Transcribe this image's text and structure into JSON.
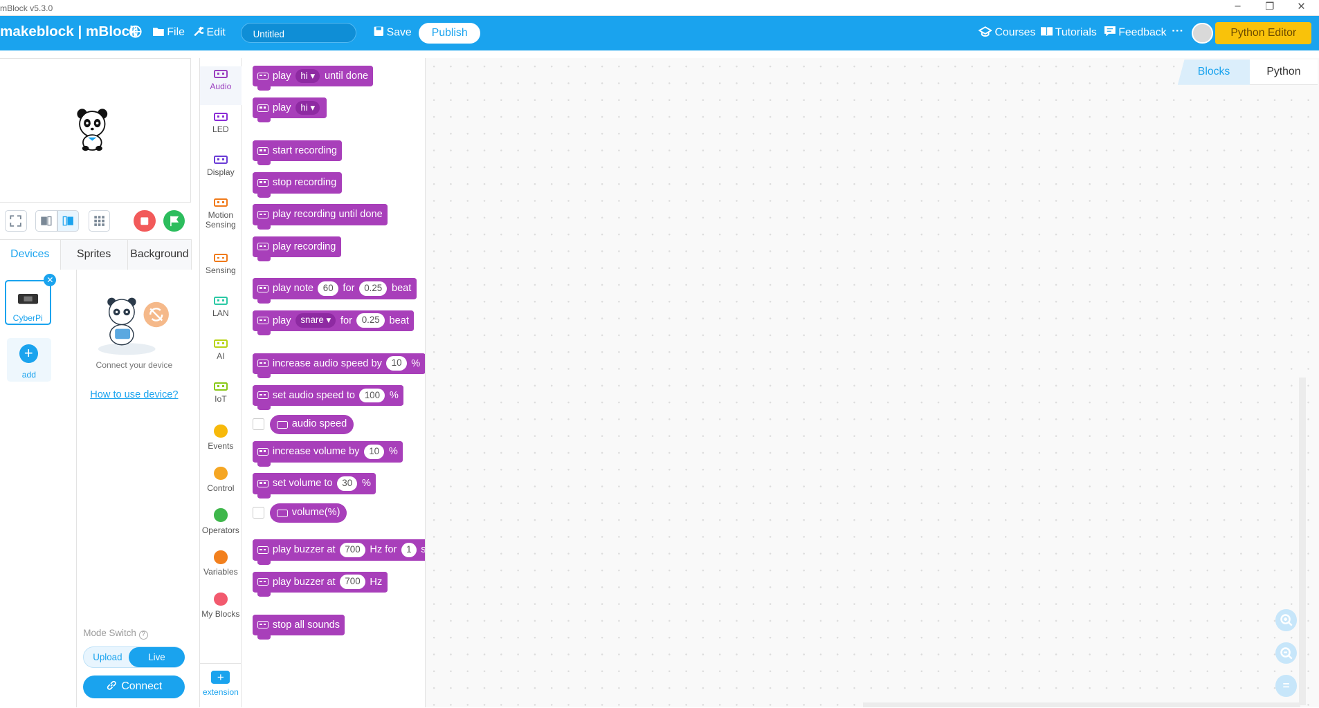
{
  "window": {
    "title": "mBlock v5.3.0",
    "minimize": "–",
    "restore": "❐",
    "close": "✕"
  },
  "menubar": {
    "brand": "makeblock | mBlock",
    "file": "File",
    "edit": "Edit",
    "project_title": "Untitled",
    "save": "Save",
    "publish": "Publish",
    "courses": "Courses",
    "tutorials": "Tutorials",
    "feedback": "Feedback",
    "more": "···",
    "python_editor": "Python Editor"
  },
  "tabs": {
    "devices": "Devices",
    "sprites": "Sprites",
    "background": "Background"
  },
  "devices": {
    "items": [
      {
        "label": "CyberPi"
      }
    ],
    "add_label": "add",
    "connect_hint": "Connect your device",
    "how_to_link": "How to use device?",
    "mode_switch_label": "Mode Switch",
    "mode_upload": "Upload",
    "mode_live": "Live",
    "connect_button": "Connect"
  },
  "categories": [
    {
      "label": "Audio",
      "color": "#9b3fbf",
      "shape": "chip"
    },
    {
      "label": "LED",
      "color": "#8a2bd6",
      "shape": "chip"
    },
    {
      "label": "Display",
      "color": "#6a3bd6",
      "shape": "chip"
    },
    {
      "label": "Motion Sensing",
      "color": "#f07a1a",
      "shape": "chip"
    },
    {
      "label": "Sensing",
      "color": "#f07a1a",
      "shape": "chip"
    },
    {
      "label": "LAN",
      "color": "#2bc9a5",
      "shape": "chip"
    },
    {
      "label": "AI",
      "color": "#b8d414",
      "shape": "chip"
    },
    {
      "label": "IoT",
      "color": "#8bc91a",
      "shape": "chip"
    },
    {
      "label": "Events",
      "color": "#f7b90a",
      "shape": "dot"
    },
    {
      "label": "Control",
      "color": "#f5a623",
      "shape": "dot"
    },
    {
      "label": "Operators",
      "color": "#3fb74b",
      "shape": "dot"
    },
    {
      "label": "Variables",
      "color": "#f2801e",
      "shape": "dot"
    },
    {
      "label": "My Blocks",
      "color": "#f25a6e",
      "shape": "dot"
    }
  ],
  "extension_label": "extension",
  "blocks": {
    "b1": {
      "t1": "play",
      "dd": "hi",
      "t2": "until done"
    },
    "b2": {
      "t1": "play",
      "dd": "hi"
    },
    "b3": {
      "t1": "start recording"
    },
    "b4": {
      "t1": "stop recording"
    },
    "b5": {
      "t1": "play recording until done"
    },
    "b6": {
      "t1": "play recording"
    },
    "b7": {
      "t1": "play note",
      "v1": "60",
      "t2": "for",
      "v2": "0.25",
      "t3": "beat"
    },
    "b8": {
      "t1": "play",
      "dd": "snare",
      "t2": "for",
      "v2": "0.25",
      "t3": "beat"
    },
    "b9": {
      "t1": "increase audio speed by",
      "v1": "10",
      "t2": "%"
    },
    "b10": {
      "t1": "set audio speed to",
      "v1": "100",
      "t2": "%"
    },
    "b11": {
      "t1": "audio speed"
    },
    "b12": {
      "t1": "increase volume by",
      "v1": "10",
      "t2": "%"
    },
    "b13": {
      "t1": "set volume to",
      "v1": "30",
      "t2": "%"
    },
    "b14": {
      "t1": "volume(%)"
    },
    "b15": {
      "t1": "play buzzer at",
      "v1": "700",
      "t2": "Hz for",
      "v2": "1",
      "t3": "se"
    },
    "b16": {
      "t1": "play buzzer at",
      "v1": "700",
      "t2": "Hz"
    },
    "b17": {
      "t1": "stop all sounds"
    }
  },
  "view_tabs": {
    "blocks": "Blocks",
    "python": "Python"
  },
  "zoom": {
    "in": "+",
    "out": "−",
    "reset": "="
  }
}
